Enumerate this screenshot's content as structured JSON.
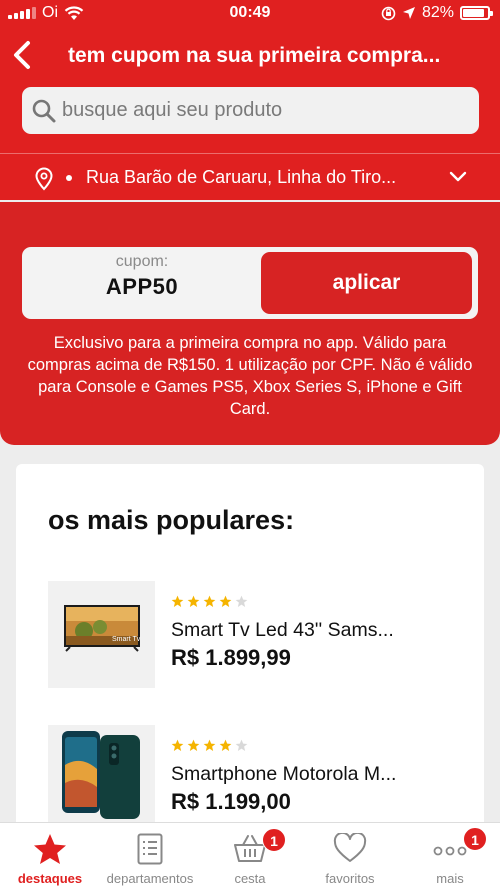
{
  "status_bar": {
    "carrier": "Oi",
    "time": "00:49",
    "battery": "82%",
    "icons": [
      "signal-icon",
      "wifi-icon",
      "rotation-lock-icon",
      "location-arrow-icon",
      "battery-icon"
    ]
  },
  "header": {
    "title": "tem cupom na sua primeira compra...",
    "back_icon": "chevron-left-icon"
  },
  "search": {
    "placeholder": "busque aqui seu produto",
    "icon": "search-icon"
  },
  "address": {
    "text": "Rua Barão de Caruaru, Linha do Tiro...",
    "icon": "location-pin-icon",
    "dropdown_icon": "chevron-down-icon"
  },
  "coupon": {
    "label": "cupom:",
    "code": "APP50",
    "apply_label": "aplicar",
    "description": "Exclusivo para a primeira compra no app. Válido para compras acima de R$150. 1 utilização por CPF. Não é válido para Console e Games PS5, Xbox Series S, iPhone e Gift Card."
  },
  "popular": {
    "title": "os mais populares:",
    "products": [
      {
        "name": "Smart Tv Led 43'' Sams...",
        "price": "R$ 1.899,99",
        "rating": 4,
        "max_rating": 5,
        "thumb_text": "Smart Tv"
      },
      {
        "name": "Smartphone Motorola M...",
        "price": "R$ 1.199,00",
        "rating": 4,
        "max_rating": 5
      }
    ]
  },
  "bottom_nav": {
    "items": [
      {
        "label": "destaques",
        "icon": "star-icon",
        "active": true
      },
      {
        "label": "departamentos",
        "icon": "list-icon"
      },
      {
        "label": "cesta",
        "icon": "basket-icon",
        "badge": "1"
      },
      {
        "label": "favoritos",
        "icon": "heart-icon"
      },
      {
        "label": "mais",
        "icon": "more-icon",
        "badge": "1"
      }
    ]
  },
  "colors": {
    "brand_red": "#e02020",
    "star_gold": "#f5b400",
    "star_empty": "#d9d9d9"
  }
}
